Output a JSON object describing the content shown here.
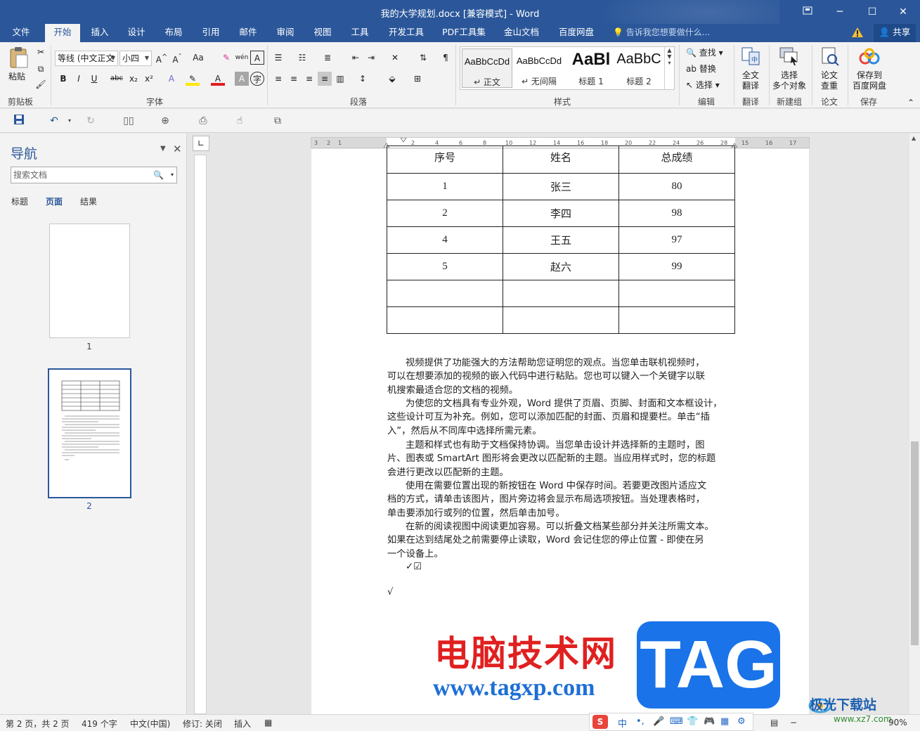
{
  "window": {
    "title": "我的大学规划.docx [兼容模式] - Word",
    "restore_icon": "ribbon-display-icon",
    "min": "─",
    "max": "☐",
    "close": "✕"
  },
  "tabs": [
    "文件",
    "开始",
    "插入",
    "设计",
    "布局",
    "引用",
    "邮件",
    "审阅",
    "视图",
    "工具",
    "开发工具",
    "PDF工具集",
    "金山文档",
    "百度网盘"
  ],
  "active_tab": "开始",
  "tell_me": "告诉我您想要做什么...",
  "share": "共享",
  "ribbon": {
    "clipboard": {
      "paste": "粘贴",
      "label": "剪贴板"
    },
    "font": {
      "name": "等线 (中文正文",
      "size": "小四",
      "label": "字体"
    },
    "paragraph": {
      "label": "段落"
    },
    "styles": {
      "label": "样式",
      "items": [
        {
          "sample": "AaBbCcDd",
          "name": "↵ 正文"
        },
        {
          "sample": "AaBbCcDd",
          "name": "↵ 无间隔"
        },
        {
          "sample": "AaBl",
          "name": "标题 1"
        },
        {
          "sample": "AaBbC",
          "name": "标题 2"
        }
      ]
    },
    "editing": {
      "find": "查找",
      "replace": "替换",
      "select": "选择",
      "label": "编辑"
    },
    "translate": {
      "btn1": "全文",
      "btn2": "翻译",
      "label": "翻译"
    },
    "newgroup": {
      "btn1": "选择",
      "btn2": "多个对象",
      "label": "新建组"
    },
    "paper": {
      "btn1": "论文",
      "btn2": "查重",
      "label": "论文"
    },
    "save": {
      "btn1": "保存到",
      "btn2": "百度网盘",
      "label": "保存"
    }
  },
  "nav": {
    "title": "导航",
    "search_placeholder": "搜索文档",
    "tabs": [
      "标题",
      "页面",
      "结果"
    ],
    "active_tab": "页面",
    "pages": [
      "1",
      "2"
    ]
  },
  "table": {
    "header": [
      "序号",
      "姓名",
      "总成绩"
    ],
    "rows": [
      [
        "1",
        "张三",
        "80"
      ],
      [
        "2",
        "李四",
        "98"
      ],
      [
        "4",
        "王五",
        "97"
      ],
      [
        "5",
        "赵六",
        "99"
      ],
      [
        "",
        "",
        ""
      ],
      [
        "",
        "",
        ""
      ]
    ]
  },
  "paragraphs": [
    [
      "视频提供了功能强大的方法帮助您证明您的观点。当您单击联机视频时，",
      "可以在想要添加的视频的嵌入代码中进行粘贴。您也可以键入一个关键字以联",
      "机搜索最适合您的文档的视频。"
    ],
    [
      "为使您的文档具有专业外观，Word 提供了页眉、页脚、封面和文本框设计，",
      "这些设计可互为补充。例如，您可以添加匹配的封面、页眉和提要栏。单击“插",
      "入”，然后从不同库中选择所需元素。"
    ],
    [
      "主题和样式也有助于文档保持协调。当您单击设计并选择新的主题时，图",
      "片、图表或 SmartArt 图形将会更改以匹配新的主题。当应用样式时，您的标题",
      "会进行更改以匹配新的主题。"
    ],
    [
      "使用在需要位置出现的新按钮在 Word 中保存时间。若要更改图片适应文",
      "档的方式，请单击该图片，图片旁边将会显示布局选项按钮。当处理表格时，",
      "单击要添加行或列的位置，然后单击加号。"
    ],
    [
      "在新的阅读视图中阅读更加容易。可以折叠文档某些部分并关注所需文本。",
      "如果在达到结尾处之前需要停止读取，Word 会记住您的停止位置 - 即使在另",
      "一个设备上。"
    ]
  ],
  "checkline": "✓☑",
  "checkmark": "√",
  "status": {
    "page": "第 2 页，共 2 页",
    "words": "419 个字",
    "lang": "中文(中国)",
    "track": "修订: 关闭",
    "mode": "插入",
    "zoom": "90%"
  },
  "ime": {
    "mode": "中"
  },
  "watermark": {
    "cn": "电脑技术网",
    "url": "www.tagxp.com",
    "tag": "TAG",
    "jg": "极光下载站",
    "jgurl": "www.xz7.com"
  },
  "colors": {
    "accent": "#2b579a",
    "watermark_red": "#e02020",
    "watermark_blue": "#1a73e8"
  }
}
